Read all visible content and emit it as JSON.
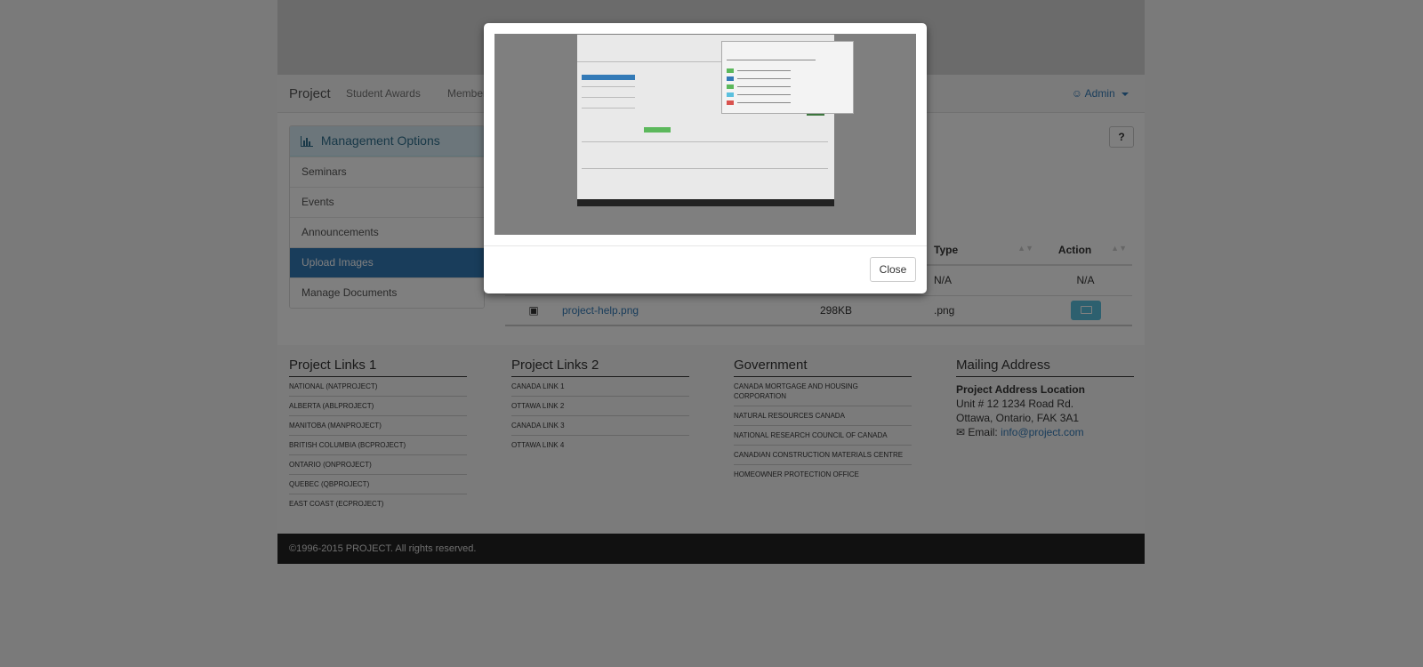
{
  "navbar": {
    "brand": "Project",
    "links": [
      "Student Awards",
      "Member"
    ],
    "admin_label": "Admin"
  },
  "management": {
    "title": "Management Options",
    "items": [
      {
        "label": "Seminars",
        "active": false
      },
      {
        "label": "Events",
        "active": false
      },
      {
        "label": "Announcements",
        "active": false
      },
      {
        "label": "Upload Images",
        "active": true
      },
      {
        "label": "Manage Documents",
        "active": false
      }
    ]
  },
  "help_button": "?",
  "table": {
    "headers": {
      "type": "Type",
      "action": "Action"
    },
    "rows": [
      {
        "name": "",
        "size": "",
        "type": "N/A",
        "action": "N/A"
      },
      {
        "name": "project-help.png",
        "size": "298KB",
        "type": ".png",
        "action": "view"
      }
    ]
  },
  "footer": {
    "links1": {
      "title": "Project Links 1",
      "items": [
        "NATIONAL (NATPROJECT)",
        "ALBERTA (ABLPROJECT)",
        "MANITOBA (MANPROJECT)",
        "BRITISH COLUMBIA (BCPROJECT)",
        "ONTARIO (ONPROJECT)",
        "QUEBEC (QBPROJECT)",
        "EAST COAST (ECPROJECT)"
      ]
    },
    "links2": {
      "title": "Project Links 2",
      "items": [
        "CANADA LINK 1",
        "OTTAWA LINK 2",
        "CANADA LINK 3",
        "OTTAWA LINK 4"
      ]
    },
    "government": {
      "title": "Government",
      "items": [
        "CANADA MORTGAGE AND HOUSING CORPORATION",
        "NATURAL RESOURCES CANADA",
        "NATIONAL RESEARCH COUNCIL OF CANADA",
        "CANADIAN CONSTRUCTION MATERIALS CENTRE",
        "HOMEOWNER PROTECTION OFFICE"
      ]
    },
    "mailing": {
      "title": "Mailing Address",
      "location": "Project Address Location",
      "line1": "Unit # 12 1234 Road Rd.",
      "line2": "Ottawa, Ontario, FAK 3A1",
      "email_label": "Email:",
      "email": "info@project.com"
    },
    "copyright": "©1996-2015 PROJECT. All rights reserved."
  },
  "modal": {
    "close_label": "Close"
  },
  "colors": {
    "primary": "#337ab7",
    "info": "#5bc0de",
    "panel_header": "#d9edf7",
    "footer_bar": "#222222"
  }
}
